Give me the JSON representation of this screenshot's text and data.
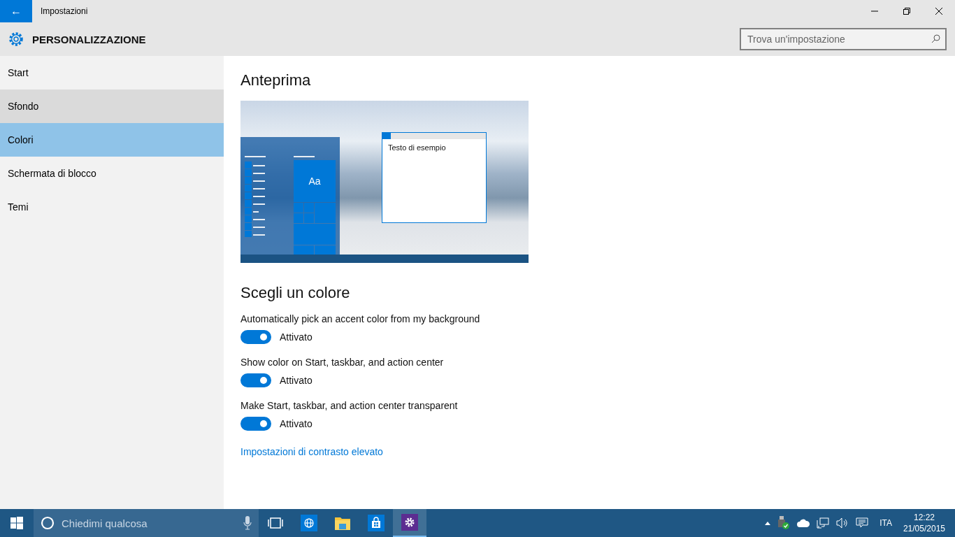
{
  "window": {
    "title": "Impostazioni",
    "back_button": "←"
  },
  "header": {
    "title": "PERSONALIZZAZIONE"
  },
  "search": {
    "placeholder": "Trova un'impostazione"
  },
  "sidebar": {
    "items": [
      {
        "label": "Start",
        "selected": false,
        "hovered": false
      },
      {
        "label": "Sfondo",
        "selected": false,
        "hovered": true
      },
      {
        "label": "Colori",
        "selected": true,
        "hovered": false
      },
      {
        "label": "Schermata di blocco",
        "selected": false,
        "hovered": false
      },
      {
        "label": "Temi",
        "selected": false,
        "hovered": false
      }
    ]
  },
  "preview": {
    "heading": "Anteprima",
    "tile_label": "Aa",
    "sample_text": "Testo di esempio"
  },
  "colors": {
    "heading": "Scegli un colore",
    "settings": [
      {
        "label": "Automatically pick an accent color from my background",
        "on": true,
        "state": "Attivato"
      },
      {
        "label": "Show color on Start, taskbar, and action center",
        "on": true,
        "state": "Attivato"
      },
      {
        "label": "Make Start, taskbar, and action center transparent",
        "on": true,
        "state": "Attivato"
      }
    ],
    "link": "Impostazioni di contrasto elevato"
  },
  "taskbar": {
    "search_placeholder": "Chiedimi qualcosa",
    "apps": [
      {
        "kind": "browser",
        "active": false
      },
      {
        "kind": "folder",
        "active": false
      },
      {
        "kind": "store",
        "active": false
      },
      {
        "kind": "settings",
        "active": true
      }
    ],
    "language": "ITA",
    "time": "12:22",
    "date": "21/05/2015"
  }
}
